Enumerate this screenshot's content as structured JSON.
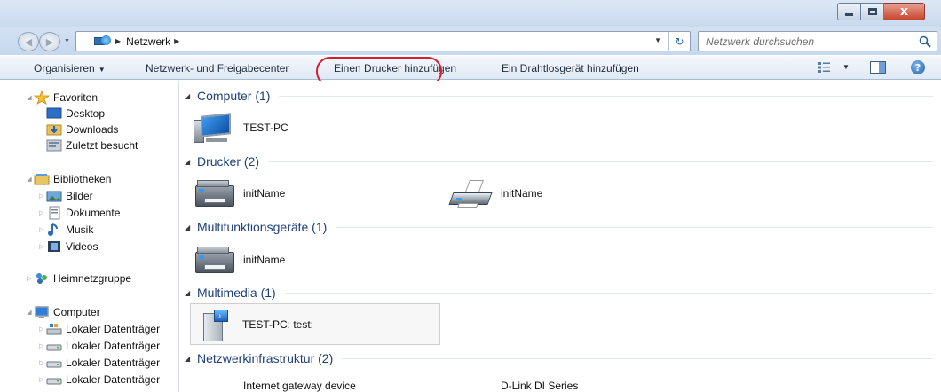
{
  "window": {
    "caption_buttons": {
      "minimize_icon": "minimize-icon",
      "maximize_icon": "maximize-icon",
      "close_glyph": "x"
    }
  },
  "address": {
    "breadcrumbs": [
      "Netzwerk"
    ],
    "search_placeholder": "Netzwerk durchsuchen"
  },
  "toolbar": {
    "organize": "Organisieren",
    "network_center": "Netzwerk- und Freigabecenter",
    "add_printer": "Einen Drucker hinzufügen",
    "add_wireless": "Ein Drahtlosgerät hinzufügen",
    "highlight_color": "#d4202a"
  },
  "sidebar": {
    "favorites": {
      "label": "Favoriten",
      "items": [
        "Desktop",
        "Downloads",
        "Zuletzt besucht"
      ]
    },
    "libraries": {
      "label": "Bibliotheken",
      "items": [
        "Bilder",
        "Dokumente",
        "Musik",
        "Videos"
      ]
    },
    "homegroup": {
      "label": "Heimnetzgruppe"
    },
    "computer": {
      "label": "Computer",
      "items": [
        "Lokaler Datenträger",
        "Lokaler Datenträger",
        "Lokaler Datenträger",
        "Lokaler Datenträger"
      ]
    }
  },
  "groups": [
    {
      "title": "Computer (1)",
      "items": [
        "TEST-PC"
      ]
    },
    {
      "title": "Drucker (2)",
      "items": [
        "initName",
        "initName"
      ]
    },
    {
      "title": "Multifunktionsgeräte (1)",
      "items": [
        "initName"
      ]
    },
    {
      "title": "Multimedia (1)",
      "items": [
        "TEST-PC: test:"
      ]
    },
    {
      "title": "Netzwerkinfrastruktur (2)",
      "items": [
        "Internet gateway device",
        "D-Link DI Series"
      ]
    }
  ],
  "colors": {
    "group_title": "#1e3f7a",
    "toolbar_bg": "#dfe9f5",
    "close_button": "#c8452f"
  }
}
